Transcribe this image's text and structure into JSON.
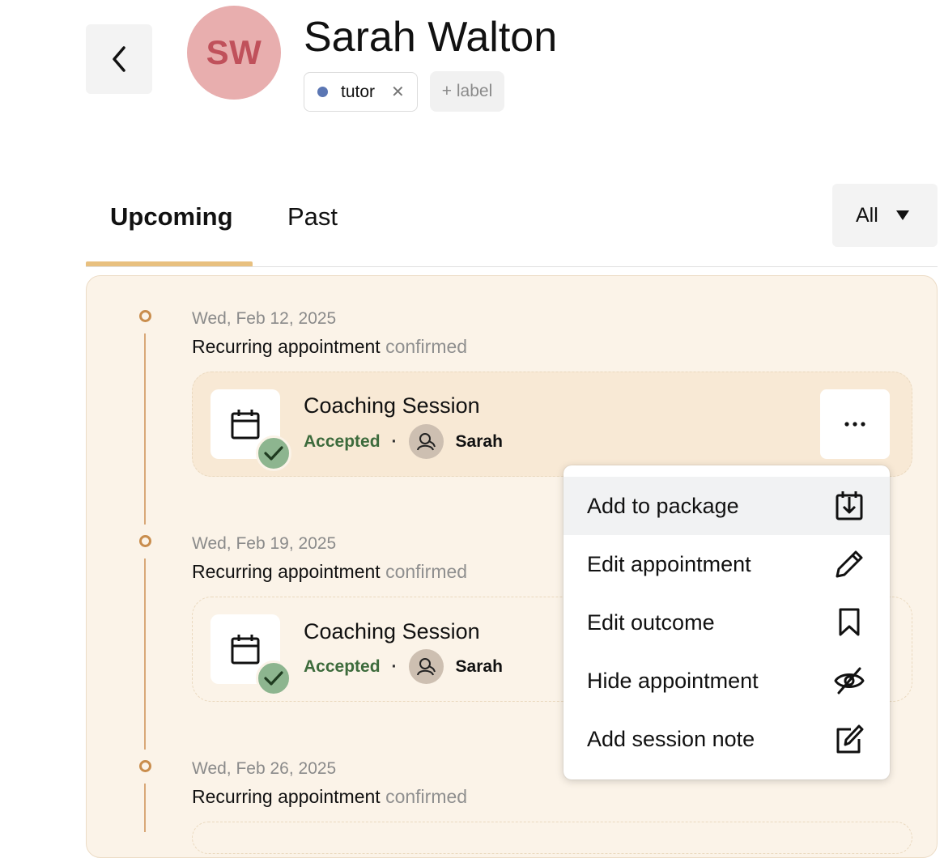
{
  "header": {
    "avatar_initials": "SW",
    "name": "Sarah Walton",
    "labels": [
      {
        "text": "tutor",
        "color": "#5b76b3"
      }
    ],
    "add_label": "+ label"
  },
  "tabs": [
    {
      "label": "Upcoming",
      "active": true
    },
    {
      "label": "Past",
      "active": false
    }
  ],
  "accent_color": "#e8c07f",
  "panel_background": "#fbf3e8",
  "filter": {
    "selected": "All"
  },
  "timeline": [
    {
      "date": "Wed, Feb 12, 2025",
      "event": "Recurring appointment",
      "status": "confirmed",
      "card": {
        "title": "Coaching Session",
        "state": "Accepted",
        "owner": "Sarah"
      }
    },
    {
      "date": "Wed, Feb 19, 2025",
      "event": "Recurring appointment",
      "status": "confirmed",
      "card": {
        "title": "Coaching Session",
        "state": "Accepted",
        "owner": "Sarah"
      }
    },
    {
      "date": "Wed, Feb 26, 2025",
      "event": "Recurring appointment",
      "status": "confirmed"
    }
  ],
  "menu": {
    "items": [
      {
        "label": "Add to package",
        "icon": "package-download-icon"
      },
      {
        "label": "Edit appointment",
        "icon": "pencil-icon"
      },
      {
        "label": "Edit outcome",
        "icon": "bookmark-icon"
      },
      {
        "label": "Hide appointment",
        "icon": "eye-off-icon"
      },
      {
        "label": "Add session note",
        "icon": "note-edit-icon"
      }
    ]
  }
}
